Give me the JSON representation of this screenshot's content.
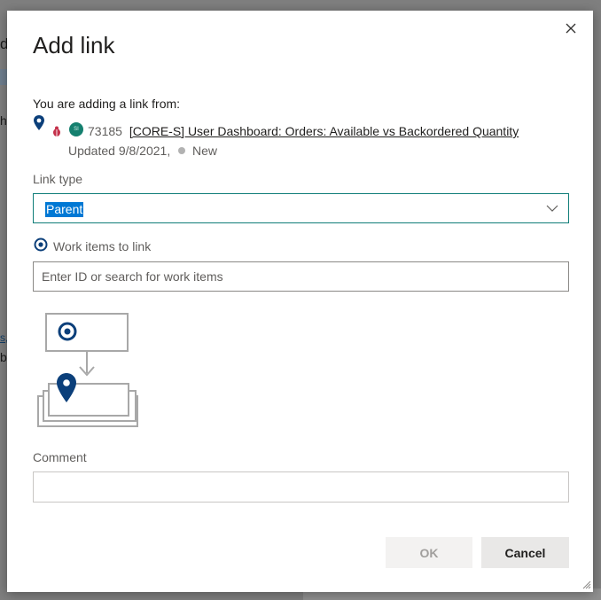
{
  "background": {
    "fragments": [
      "de",
      "h",
      "s,",
      "b"
    ]
  },
  "dialog": {
    "title": "Add link",
    "from_label": "You are adding a link from:",
    "work_item": {
      "id": "73185",
      "title": "[CORE-S] User Dashboard: Orders: Available vs Backordered Quantity",
      "updated": "Updated 9/8/2021,",
      "state": "New",
      "avatar_initials": "SI",
      "icons": [
        "pin-icon",
        "bug-icon"
      ]
    },
    "link_type": {
      "label": "Link type",
      "value": "Parent",
      "icon": "chevron-down-icon"
    },
    "work_items": {
      "label": "Work items to link",
      "placeholder": "Enter ID or search for work items",
      "value": ""
    },
    "comment": {
      "label": "Comment",
      "value": ""
    },
    "buttons": {
      "ok": "OK",
      "cancel": "Cancel"
    }
  },
  "colors": {
    "accent": "#0f7d78",
    "selection": "#0078d4",
    "icon_blue": "#0b3f7a",
    "bug_red": "#c4314b",
    "avatar_green": "#15806f"
  }
}
